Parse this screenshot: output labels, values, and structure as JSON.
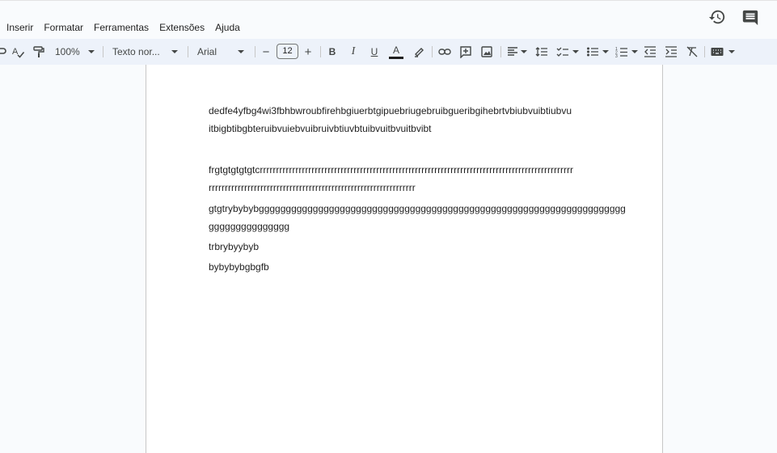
{
  "menu": {
    "items": [
      "Inserir",
      "Formatar",
      "Ferramentas",
      "Extensões",
      "Ajuda"
    ]
  },
  "header_icons": {
    "history": "history-icon",
    "comments": "comment-icon"
  },
  "toolbar": {
    "zoom": "100%",
    "style": "Texto nor...",
    "font": "Arial",
    "font_size": "12",
    "minus": "−",
    "plus": "+",
    "bold": "B",
    "italic": "I",
    "underline": "U",
    "text_color": "A",
    "accent_color": "#1f1f1f"
  },
  "document": {
    "lines": [
      "dedfe4yfbg4wi3fbhbwroubfirehbgiuerbtgipuebriugebruibgueribgihebrtvbiubvuibtiubvu",
      "itbigbtibgbteruibvuiebvuibruivbtiuvbtuibvuitbvuitbvibt",
      "frgtgtgtgtgtcrrrrrrrrrrrrrrrrrrrrrrrrrrrrrrrrrrrrrrrrrrrrrrrrrrrrrrrrrrrrrrrrrrrrrrrrrrrrrrrrrrrrrrrrrrrrrrrrr",
      "rrrrrrrrrrrrrrrrrrrrrrrrrrrrrrrrrrrrrrrrrrrrrrrrrrrrrrrrrrrrrrrr",
      "gtgtrybybybgggggggggggggggggggggggggggggggggggggggggggggggggggggggggggggggggggg",
      "ggggggggggggggg",
      "trbrybyybyb",
      "bybybybgbgfb"
    ]
  }
}
